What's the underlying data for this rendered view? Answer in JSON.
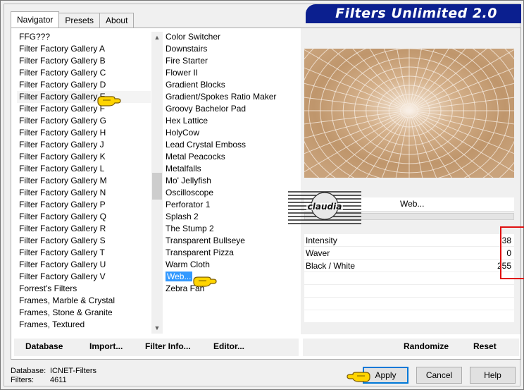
{
  "window": {
    "title": "Filters Unlimited 2.0"
  },
  "tabs": [
    {
      "label": "Navigator"
    },
    {
      "label": "Presets"
    },
    {
      "label": "About"
    }
  ],
  "categories": [
    "FFG???",
    "Filter Factory Gallery A",
    "Filter Factory Gallery B",
    "Filter Factory Gallery C",
    "Filter Factory Gallery D",
    "Filter Factory Gallery E",
    "Filter Factory Gallery F",
    "Filter Factory Gallery G",
    "Filter Factory Gallery H",
    "Filter Factory Gallery J",
    "Filter Factory Gallery K",
    "Filter Factory Gallery L",
    "Filter Factory Gallery M",
    "Filter Factory Gallery N",
    "Filter Factory Gallery P",
    "Filter Factory Gallery Q",
    "Filter Factory Gallery R",
    "Filter Factory Gallery S",
    "Filter Factory Gallery T",
    "Filter Factory Gallery U",
    "Filter Factory Gallery V",
    "Forrest's Filters",
    "Frames, Marble & Crystal",
    "Frames, Stone & Granite",
    "Frames, Textured"
  ],
  "selected_category": "Filter Factory Gallery E",
  "filters": [
    "Color Switcher",
    "Downstairs",
    "Fire Starter",
    "Flower II",
    "Gradient Blocks",
    "Gradient/Spokes Ratio Maker",
    "Groovy Bachelor Pad",
    "Hex Lattice",
    "HolyCow",
    "Lead Crystal Emboss",
    "Metal Peacocks",
    "Metalfalls",
    "Mo' Jellyfish",
    "Oscilloscope",
    "Perforator 1",
    "Splash 2",
    "The Stump 2",
    "Transparent Bullseye",
    "Transparent Pizza",
    "Warm Cloth",
    "Web...",
    "Zebra Fan"
  ],
  "selected_filter": "Web...",
  "preview": {
    "filter_button_label": "Web..."
  },
  "parameters": [
    {
      "label": "Intensity",
      "value": "38"
    },
    {
      "label": "Waver",
      "value": "0"
    },
    {
      "label": "Black / White",
      "value": "255"
    }
  ],
  "stamp": {
    "text": "claudia"
  },
  "bottom_left_buttons": {
    "database": "Database",
    "import": "Import...",
    "filter_info": "Filter Info...",
    "editor": "Editor..."
  },
  "bottom_right_buttons": {
    "randomize": "Randomize",
    "reset": "Reset"
  },
  "footer": {
    "database_label": "Database:",
    "database_value": "ICNET-Filters",
    "filters_label": "Filters:",
    "filters_value": "4611"
  },
  "dialog_buttons": {
    "apply": "Apply",
    "cancel": "Cancel",
    "help": "Help"
  },
  "colors": {
    "banner": "#0b1f8f",
    "selection": "#3399ff",
    "highlight_box": "#e01010",
    "pointer": "#ffd400"
  }
}
